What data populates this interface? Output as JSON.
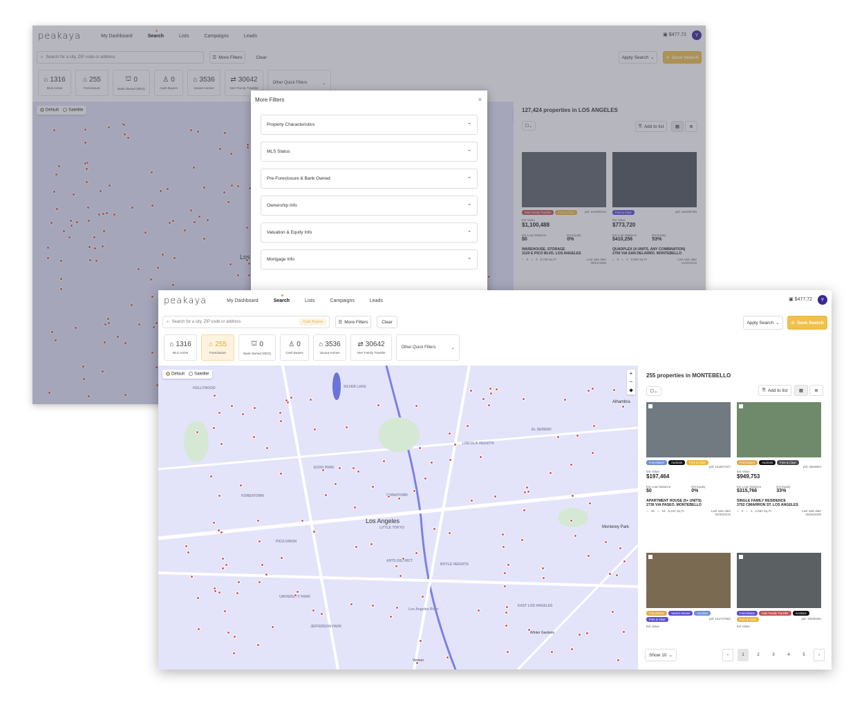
{
  "app": {
    "logo": "peakaya"
  },
  "nav": {
    "items": [
      "My Dashboard",
      "Search",
      "Lists",
      "Campaigns",
      "Leads"
    ],
    "active": "Search",
    "credit": "$477.72",
    "avatar_initial": "Y"
  },
  "searchbar": {
    "placeholder": "Search for a city, ZIP code or address",
    "more_filters": "More Filters",
    "clear": "Clear",
    "apply_search": "Apply Search",
    "save_search": "Save Search",
    "chips": [
      "Cash Buyers"
    ]
  },
  "quick_filters": [
    {
      "count": "1316",
      "label": "MLS Active",
      "icon": "house-check-icon"
    },
    {
      "count": "255",
      "label": "Foreclosure",
      "icon": "house-warning-icon"
    },
    {
      "count": "0",
      "label": "Bank Owned (REO)",
      "icon": "bank-icon"
    },
    {
      "count": "0",
      "label": "Cash Buyers",
      "icon": "cash-buyer-icon"
    },
    {
      "count": "3536",
      "label": "Vacant Homes",
      "icon": "vacant-home-icon"
    },
    {
      "count": "30642",
      "label": "Inter Family Transfer",
      "icon": "family-transfer-icon"
    }
  ],
  "other_quick_filters": "Other Quick Filters",
  "map": {
    "toggle": [
      "Default",
      "Satellite"
    ],
    "city_label": "Los Angeles",
    "back_city_label": "Los",
    "labels": [
      "Alhambra",
      "Monterey Park",
      "Winter Gardens",
      "Vernon",
      "HOLLYWOOD",
      "CHINATOWN",
      "ECHO PARK",
      "SILVER LAKE",
      "KOREATOWN",
      "PICO-UNION",
      "BOYLE HEIGHTS",
      "LITTLE TOKYO",
      "ARTS DISTRICT",
      "EAST LOS ANGELES",
      "UNIVERSITY PARK",
      "JEFFERSON PARK",
      "LINCOLN HEIGHTS",
      "EL SERENO",
      "Los Angeles River"
    ]
  },
  "back_results": {
    "title": "127,424 properties in LOS ANGELES",
    "add_to_list": "Add to list",
    "cards": [
      {
        "badges": [
          "Inter Family Transfer",
          "Free & Clear"
        ],
        "pid": "pid: 154399424",
        "est_value_label": "Est Value",
        "est_value": "$1,100,488",
        "loan_label": "Est Loan Balance",
        "loan": "$0",
        "equity_label": "Est Equity",
        "equity": "0%",
        "type": "WAREHOUSE, STORAGE",
        "address": "3120 E PICO BLVD. LOS ANGELES",
        "beds": "0",
        "baths": "0",
        "sqft": "9,738 Sq Ft",
        "last_sale_label": "Last sale date",
        "last_sale": "08/01/1996"
      },
      {
        "badges": [
          "Free & Clear"
        ],
        "pid": "pid: 155486788",
        "est_value_label": "Est Value",
        "est_value": "$773,720",
        "loan_label": "Est Loan Balance",
        "loan": "$410,256",
        "equity_label": "Est Equity",
        "equity": "53%",
        "type": "QUADPLEX (4 UNITS, ANY COMBINATION)",
        "address": "2700 VIA SAN DELARRO. MONTEBELLO",
        "beds": "6",
        "baths": "4",
        "sqft": "2,963 Sq Ft",
        "last_sale_label": "Last sale date",
        "last_sale": "11/20/2015"
      }
    ]
  },
  "modal": {
    "title": "More Filters",
    "sections": [
      "Property Characteristics",
      "MLS Status",
      "Pre-Foreclosure & Bank Owned",
      "Ownership Info",
      "Valuation & Equity Info",
      "Mortgage Info"
    ]
  },
  "results": {
    "title": "255 properties in MONTEBELLO",
    "add_to_list": "Add to list",
    "show": "Show 10",
    "pages": [
      "1",
      "2",
      "3",
      "4",
      "5"
    ],
    "cards": [
      {
        "badges": [
          "Foreclosure",
          "Auctions",
          "Free & Clear"
        ],
        "pid": "pid: 154607327",
        "est_value_label": "Est Value",
        "est_value": "$197,464",
        "loan_label": "Est Loan Balance",
        "loan": "$0",
        "equity_label": "Est Equity",
        "equity": "0%",
        "type": "APARTMENT HOUSE (5+ UNITS)",
        "address": "2736 VIA PASEO. MONTEBELLO",
        "beds": "16",
        "baths": "16",
        "sqft": "6,241 Sq Ft",
        "last_sale_label": "Last sale date",
        "last_sale": "04/30/2019"
      },
      {
        "badges": [
          "Foreclosure",
          "Auctions",
          "Free & Clear"
        ],
        "pid": "pid: 2663604",
        "est_value_label": "Est Value",
        "est_value": "$949,753",
        "loan_label": "Est Loan Balance",
        "loan": "$315,766",
        "equity_label": "Est Equity",
        "equity": "33%",
        "type": "SINGLE FAMILY RESIDENCE",
        "address": "3702 CIMARRON ST. LOS ANGELES",
        "beds": "2",
        "baths": "2",
        "sqft": "2,092 Sq Ft",
        "last_sale_label": "Last sale date",
        "last_sale": "05/26/2005"
      },
      {
        "badges": [
          "Foreclosure",
          "Vacant Homes",
          "Auctions",
          "Free & Clear"
        ],
        "pid": "pid: 154747552",
        "est_value_label": "Est Value"
      },
      {
        "badges": [
          "Foreclosure",
          "Inter Family Transfer",
          "Auctions",
          "Free & Clear"
        ],
        "pid": "pid: 19030484",
        "est_value_label": "Est Value"
      }
    ]
  }
}
